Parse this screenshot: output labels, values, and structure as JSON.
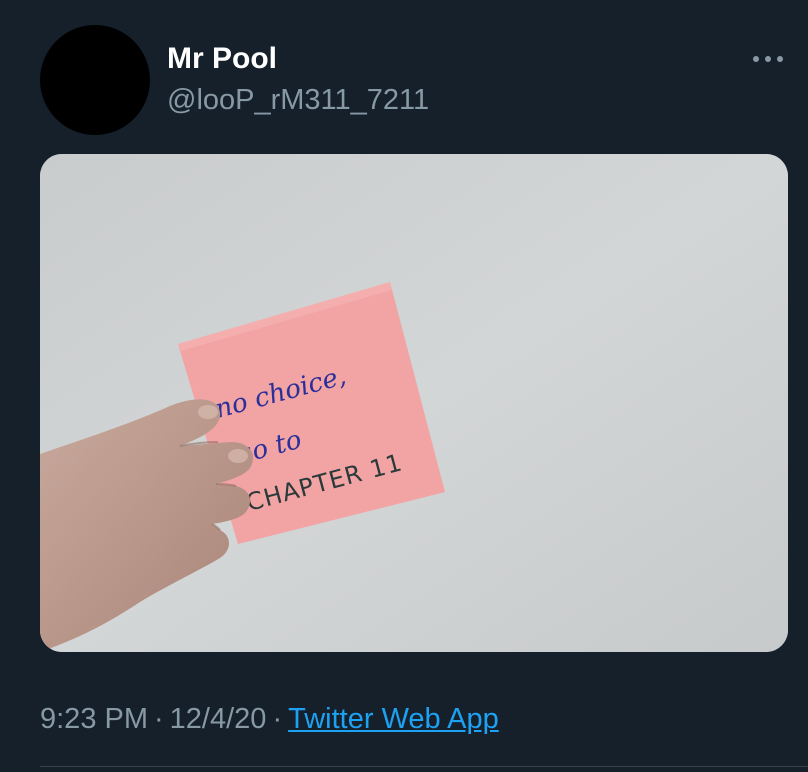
{
  "tweet": {
    "display_name": "Mr Pool",
    "handle": "@looP_rM311_7211",
    "more_icon": "more-horizontal-icon",
    "media": {
      "note_lines": [
        "no choice,",
        "go to",
        "CHAPTER 11"
      ]
    },
    "meta": {
      "time": "9:23 PM",
      "separator": "·",
      "date": "12/4/20",
      "source": "Twitter Web App"
    }
  },
  "colors": {
    "background": "#15202b",
    "name": "#ffffff",
    "secondary_text": "#8899a6",
    "link": "#1da1f2",
    "sticky_note": "#f0a0a0",
    "note_ink_blue": "#2b2f9a",
    "note_ink_dark": "#2a3a3a"
  }
}
